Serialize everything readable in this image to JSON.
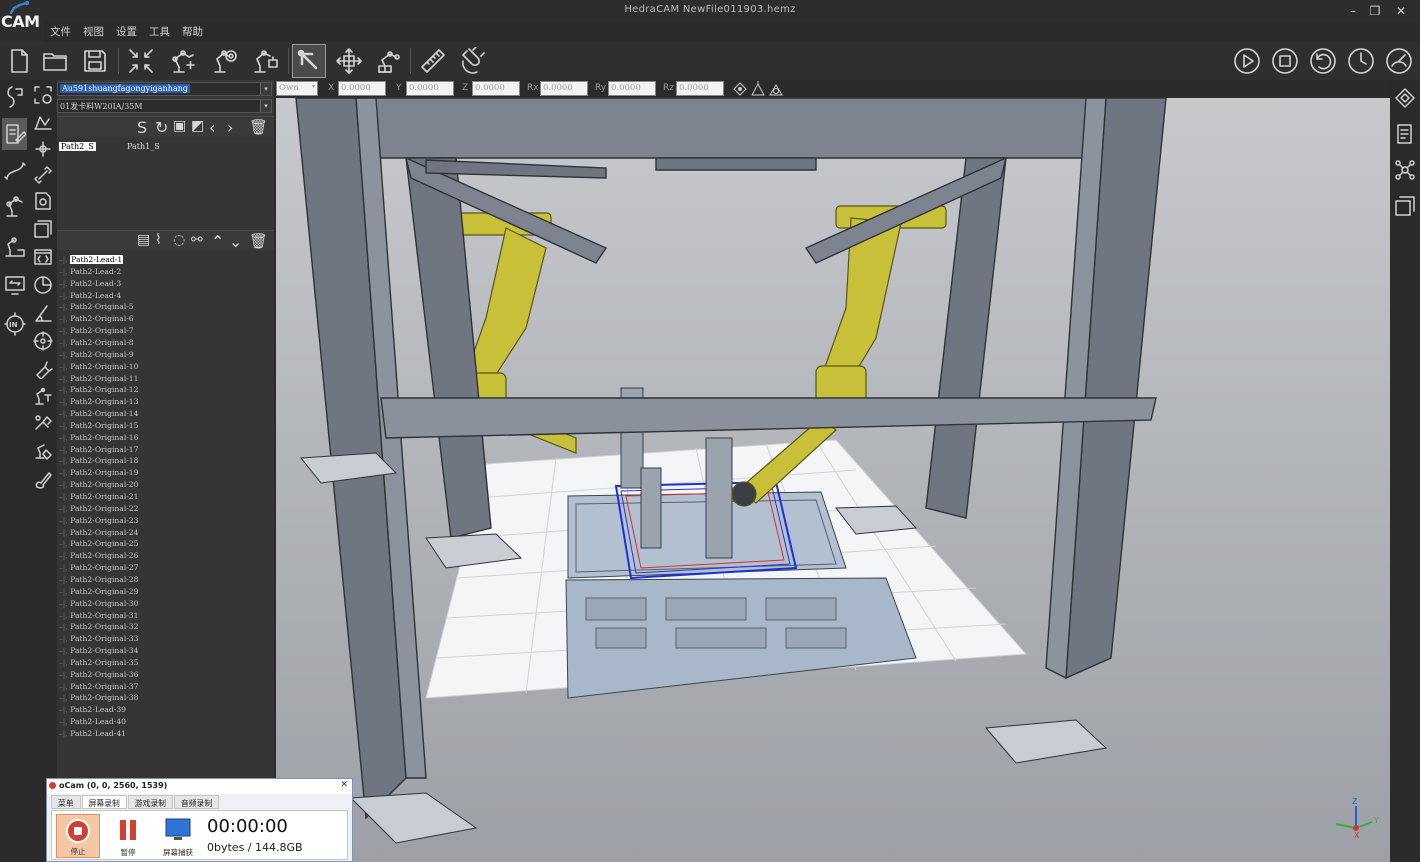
{
  "window": {
    "title": "HedraCAM   NewFile011903.hemz",
    "logo": "CAM",
    "controls": [
      "minimize",
      "restore",
      "close"
    ]
  },
  "menu": [
    "文件",
    "视图",
    "设置",
    "工具",
    "帮助"
  ],
  "toolbar": {
    "left_icons": [
      "new-file-icon",
      "open-folder-icon",
      "save-icon",
      "fit-view-icon",
      "robot-path-icon",
      "robot-settings-icon",
      "robot-frame-icon",
      "select-arrow-icon",
      "move-icon",
      "robot-base-icon",
      "measure-ruler-icon",
      "magnet-icon"
    ],
    "right_icons": [
      "play-icon",
      "stop-icon",
      "reset-icon",
      "timer-icon",
      "gauge-icon"
    ],
    "active": "select-arrow-icon"
  },
  "coords": {
    "frame": "Own",
    "x_label": "X",
    "x": "0.0000",
    "y_label": "Y",
    "y": "0.0000",
    "z_label": "Z",
    "z": "0.0000",
    "rx_label": "Rx",
    "rx": "0.0000",
    "ry_label": "Ry",
    "ry": "0.0000",
    "rz_label": "Rz",
    "rz": "0.0000"
  },
  "panel": {
    "combo1": "Au591shuangfagongyiganhang",
    "combo2": "01发卡料W20IA/35M",
    "path_tabs": [
      "Path2_S",
      "Path1_S"
    ],
    "selected_path": "Path2_S",
    "tree_items": [
      "Path2-Lead-1",
      "Path2-Lead-2",
      "Path2-Lead-3",
      "Path2-Lead-4",
      "Path2-Original-5",
      "Path2-Original-6",
      "Path2-Original-7",
      "Path2-Original-8",
      "Path2-Original-9",
      "Path2-Original-10",
      "Path2-Original-11",
      "Path2-Original-12",
      "Path2-Original-13",
      "Path2-Original-14",
      "Path2-Original-15",
      "Path2-Original-16",
      "Path2-Original-17",
      "Path2-Original-18",
      "Path2-Original-19",
      "Path2-Original-20",
      "Path2-Original-21",
      "Path2-Original-22",
      "Path2-Original-23",
      "Path2-Original-24",
      "Path2-Original-25",
      "Path2-Original-26",
      "Path2-Original-27",
      "Path2-Original-28",
      "Path2-Original-29",
      "Path2-Original-30",
      "Path2-Original-31",
      "Path2-Original-32",
      "Path2-Original-33",
      "Path2-Original-34",
      "Path2-Original-35",
      "Path2-Original-36",
      "Path2-Original-37",
      "Path2-Original-38",
      "Path2-Lead-39",
      "Path2-Lead-40",
      "Path2-Lead-41"
    ],
    "selected_item": "Path2-Lead-1"
  },
  "ocam": {
    "title": "oCam (0, 0, 2560, 1539)",
    "tabs": [
      "菜单",
      "屏幕录制",
      "游戏录制",
      "音频录制"
    ],
    "active_tab": "屏幕录制",
    "stop_label": "停止",
    "pause_label": "暂停",
    "capture_label": "屏幕捕获",
    "time": "00:00:00",
    "size": "0bytes / 144.8GB"
  },
  "colors": {
    "robot": "#c9c03a",
    "frame": "#6f7682",
    "floor": "#f1f2f4",
    "path_blue": "#1d2fd6",
    "path_red": "#d0342c"
  }
}
